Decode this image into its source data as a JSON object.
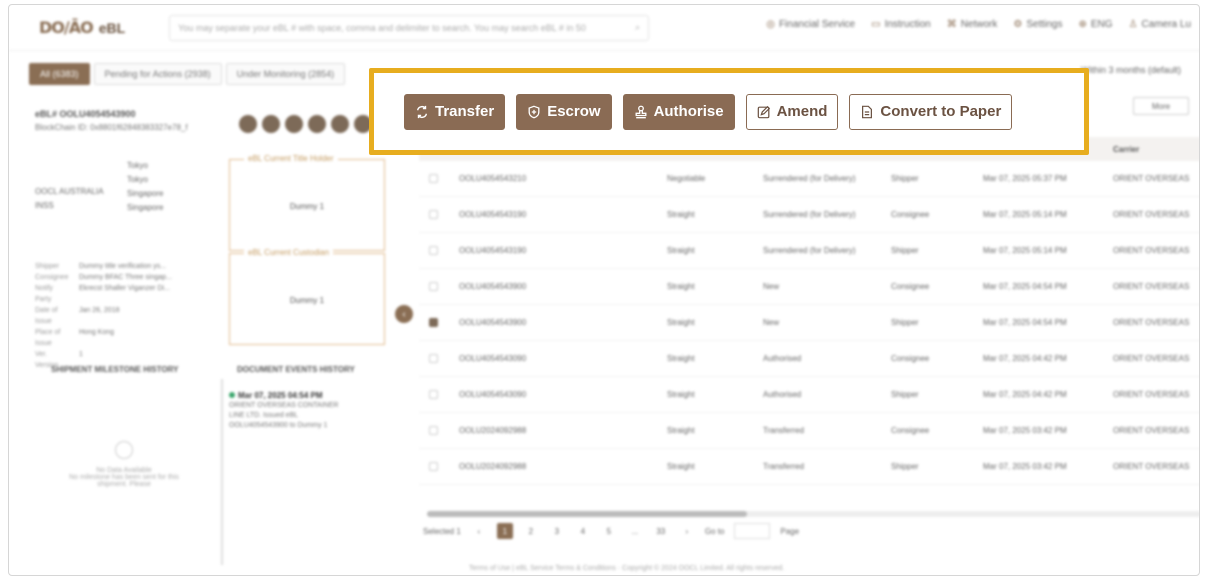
{
  "header": {
    "logo_mark": "DO∕ĀO",
    "app_name": "eBL",
    "search_placeholder": "You may separate your eBL # with space, comma and delimiter to search. You may search eBL # in 50",
    "nav": [
      {
        "icon": "financial-service-icon",
        "label": "Financial Service"
      },
      {
        "icon": "instruction-icon",
        "label": "Instruction"
      },
      {
        "icon": "network-icon",
        "label": "Network"
      },
      {
        "icon": "settings-icon",
        "label": "Settings"
      },
      {
        "icon": "language-icon",
        "label": "ENG"
      },
      {
        "icon": "user-icon",
        "label": "Camera Lu"
      }
    ]
  },
  "tabs": [
    {
      "label": "All (6383)",
      "active": true
    },
    {
      "label": "Pending for Actions (2938)",
      "active": false
    },
    {
      "label": "Under Monitoring (2854)",
      "active": false
    }
  ],
  "filter_label": "Within 3 months (default)",
  "more_label": "More",
  "actions": {
    "transfer": "Transfer",
    "escrow": "Escrow",
    "authorise": "Authorise",
    "amend": "Amend",
    "convert": "Convert to Paper"
  },
  "left": {
    "doc_id": "eBL# OOLU4054543900",
    "chain_id": "BlockChain ID: 0x8801f62848383327e78_f",
    "route_origin": "OOCL AUSTRALIA",
    "route_origin_2": "INSS",
    "stops": [
      "Tokyo",
      "Tokyo",
      "Singapore",
      "Singapore"
    ],
    "details": [
      {
        "k": "Shipper",
        "v": "Dummy title verification ys..."
      },
      {
        "k": "Consignee",
        "v": "Dummy BFAC Three singap..."
      },
      {
        "k": "Notify Party",
        "v": "Ekrecst Shaller Viganzer Di..."
      },
      {
        "k": "Date of Issue",
        "v": "Jan 26, 2018"
      },
      {
        "k": "Place of Issue",
        "v": "Hong Kong"
      },
      {
        "k": "Ver. Version",
        "v": "1"
      }
    ],
    "title_holder_caption": "eBL Current Title Holder",
    "title_holder_value": "Dummy 1",
    "custodian_caption": "eBL Current Custodian",
    "custodian_value": "Dummy 1",
    "milestone_heading": "SHIPMENT MILESTONE HISTORY",
    "events_heading": "DOCUMENT EVENTS HISTORY",
    "event_time": "Mar 07, 2025 04:54 PM",
    "event_line1": "ORIENT OVERSEAS CONTAINER",
    "event_line2": "LINE LTD. Issued eBL",
    "event_line3": "OOLU4054543900 to Dummy 1",
    "nodata_title": "No Data Available",
    "nodata_sub": "No milestone has been sent for this shipment. Please"
  },
  "table": {
    "headers": [
      "",
      "",
      "",
      "",
      "",
      "Carrier"
    ],
    "rows": [
      {
        "id": "OOLU4054543210",
        "type": "Negotiable",
        "status": "Surrendered (for Delivery)",
        "role": "Shipper",
        "date": "Mar 07, 2025 05:37 PM",
        "carrier": "ORIENT OVERSEAS",
        "checked": false
      },
      {
        "id": "OOLU4054543190",
        "type": "Straight",
        "status": "Surrendered (for Delivery)",
        "role": "Consignee",
        "date": "Mar 07, 2025 05:14 PM",
        "carrier": "ORIENT OVERSEAS",
        "checked": false
      },
      {
        "id": "OOLU4054543190",
        "type": "Straight",
        "status": "Surrendered (for Delivery)",
        "role": "Shipper",
        "date": "Mar 07, 2025 05:14 PM",
        "carrier": "ORIENT OVERSEAS",
        "checked": false
      },
      {
        "id": "OOLU4054543900",
        "type": "Straight",
        "status": "New",
        "role": "Consignee",
        "date": "Mar 07, 2025 04:54 PM",
        "carrier": "ORIENT OVERSEAS",
        "checked": false
      },
      {
        "id": "OOLU4054543900",
        "type": "Straight",
        "status": "New",
        "role": "Shipper",
        "date": "Mar 07, 2025 04:54 PM",
        "carrier": "ORIENT OVERSEAS",
        "checked": true
      },
      {
        "id": "OOLU4054543090",
        "type": "Straight",
        "status": "Authorised",
        "role": "Consignee",
        "date": "Mar 07, 2025 04:42 PM",
        "carrier": "ORIENT OVERSEAS",
        "checked": false
      },
      {
        "id": "OOLU4054543090",
        "type": "Straight",
        "status": "Authorised",
        "role": "Shipper",
        "date": "Mar 07, 2025 04:42 PM",
        "carrier": "ORIENT OVERSEAS",
        "checked": false
      },
      {
        "id": "OOLU2024092988",
        "type": "Straight",
        "status": "Transferred",
        "role": "Consignee",
        "date": "Mar 07, 2025 03:42 PM",
        "carrier": "ORIENT OVERSEAS",
        "checked": false
      },
      {
        "id": "OOLU2024092988",
        "type": "Straight",
        "status": "Transferred",
        "role": "Shipper",
        "date": "Mar 07, 2025 03:42 PM",
        "carrier": "ORIENT OVERSEAS",
        "checked": false
      }
    ]
  },
  "pager": {
    "selected": "Selected 1",
    "pages": [
      "1",
      "2",
      "3",
      "4",
      "5",
      "...",
      "33"
    ],
    "next": "›",
    "goto": "Go to",
    "page": "Page"
  },
  "footer": "Terms of Use | eBL Service Terms & Conditions · Copyright © 2024 OOCL Limited. All rights reserved.",
  "colors": {
    "accent": "#8a6b54",
    "highlight": "#e7ad1f"
  }
}
